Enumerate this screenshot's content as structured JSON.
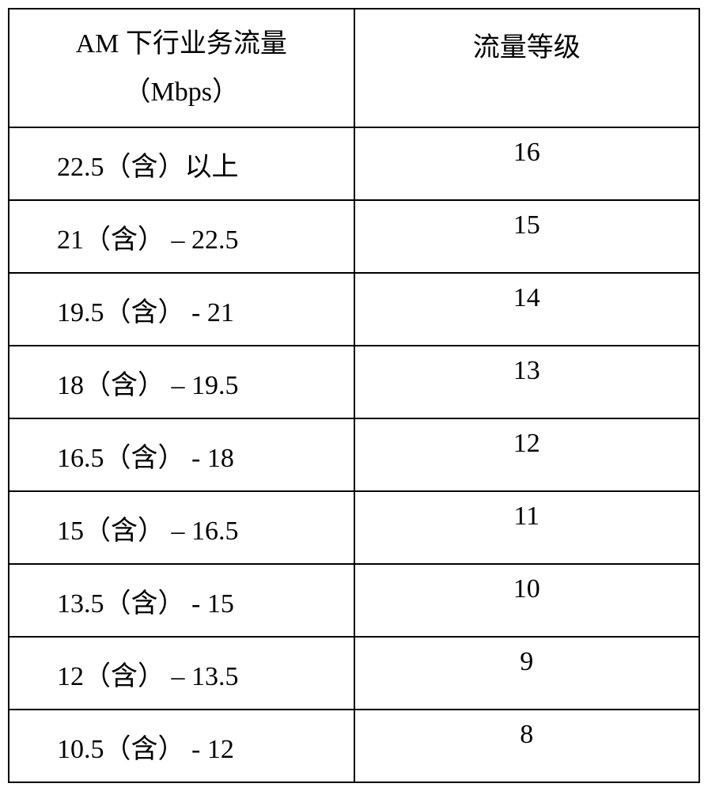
{
  "table": {
    "headers": {
      "col1_line1": "AM 下行业务流量",
      "col1_line2": "（Mbps）",
      "col2": "流量等级"
    },
    "rows": [
      {
        "range": "22.5（含）以上",
        "level": "16"
      },
      {
        "range": "21（含） – 22.5",
        "level": "15"
      },
      {
        "range": "19.5（含） - 21",
        "level": "14"
      },
      {
        "range": "18（含） – 19.5",
        "level": "13"
      },
      {
        "range": "16.5（含） - 18",
        "level": "12"
      },
      {
        "range": "15（含） – 16.5",
        "level": "11"
      },
      {
        "range": "13.5（含） - 15",
        "level": "10"
      },
      {
        "range": "12（含） – 13.5",
        "level": "9"
      },
      {
        "range": "10.5（含） - 12",
        "level": "8"
      }
    ]
  }
}
